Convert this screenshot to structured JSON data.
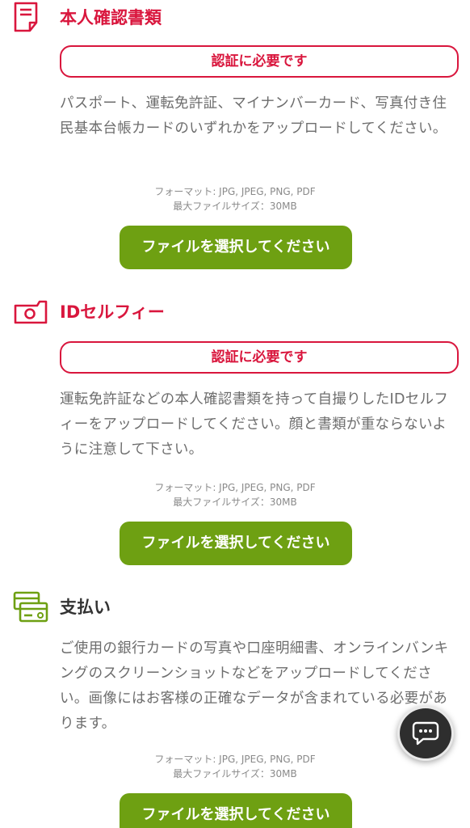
{
  "sections": [
    {
      "title": "本人確認書類",
      "badge": "認証に必要です",
      "description": "パスポート、運転免許証、マイナンバーカード、写真付き住民基本台帳カードのいずれかをアップロードしてください。",
      "format": "フォーマット: JPG, JPEG, PNG, PDF",
      "max_size": "最大ファイルサイズ：30MB",
      "button": "ファイルを選択してください",
      "icon": "document-icon"
    },
    {
      "title": "IDセルフィー",
      "badge": "認証に必要です",
      "description": "運転免許証などの本人確認書類を持って自撮りしたIDセルフィーをアップロードしてください。顔と書類が重ならないように注意して下さい。",
      "format": "フォーマット: JPG, JPEG, PNG, PDF",
      "max_size": "最大ファイルサイズ：30MB",
      "button": "ファイルを選択してください",
      "icon": "camera-icon"
    },
    {
      "title": "支払い",
      "description": "ご使用の銀行カードの写真や口座明細書、オンラインバンキングのスクリーンショットなどをアップロードしてください。画像にはお客様の正確なデータが含まれている必要があります。",
      "format": "フォーマット: JPG, JPEG, PNG, PDF",
      "max_size": "最大ファイルサイズ：30MB",
      "button": "ファイルを選択してください",
      "icon": "payment-cards-icon"
    }
  ],
  "chat": {
    "icon": "chat-bubble-icon"
  },
  "colors": {
    "accent_red": "#d9163d",
    "button_green": "#6ea012",
    "text_gray": "#6d6d6d",
    "icon_green": "#6ea012"
  }
}
